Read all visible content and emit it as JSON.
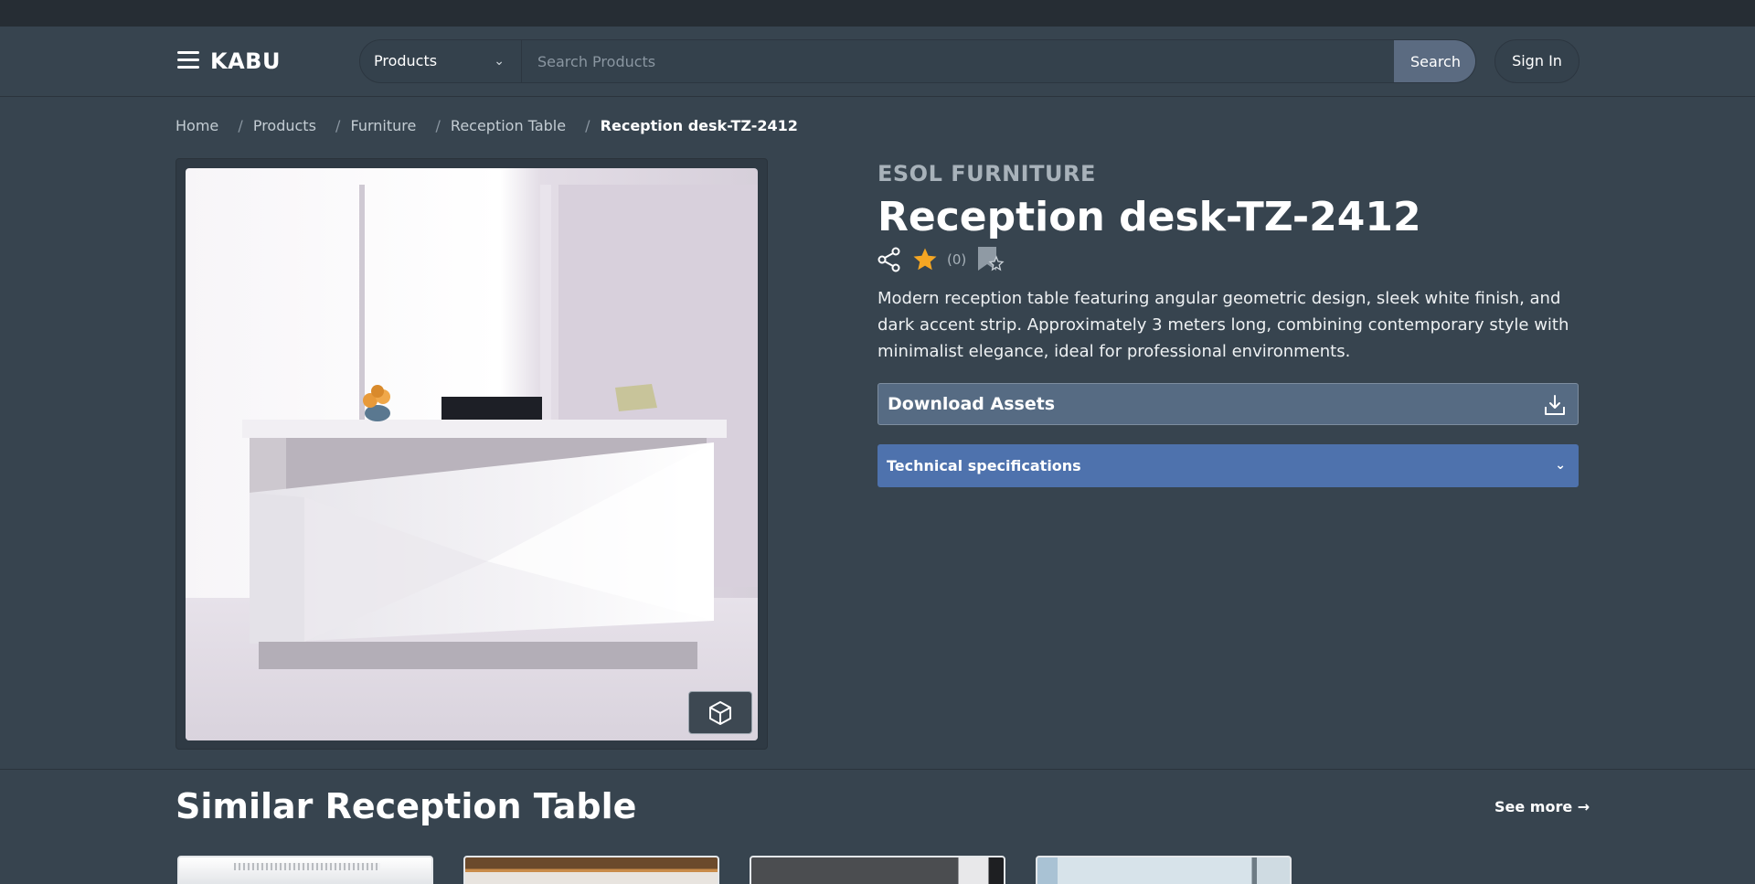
{
  "header": {
    "logo": "KABU",
    "category_select": "Products",
    "search_placeholder": "Search Products",
    "search_button": "Search",
    "sign_in": "Sign In"
  },
  "breadcrumb": [
    {
      "label": "Home"
    },
    {
      "label": "Products"
    },
    {
      "label": "Furniture"
    },
    {
      "label": "Reception Table"
    },
    {
      "label": "Reception desk-TZ-2412"
    }
  ],
  "product": {
    "brand": "ESOL FURNITURE",
    "title": "Reception desk-TZ-2412",
    "rating_count": "(0)",
    "description": "Modern reception table featuring angular geometric design, sleek white finish, and dark accent strip. Approximately 3 meters long, combining contemporary style with minimalist elegance, ideal for professional environments.",
    "download_label": "Download Assets",
    "tech_spec_label": "Technical specifications"
  },
  "similar": {
    "title": "Similar Reception Table",
    "see_more": "See more →"
  },
  "colors": {
    "background": "#37444f",
    "accent_blue": "#4e72ad",
    "download_bg": "#566b83",
    "star": "#f5a623"
  }
}
